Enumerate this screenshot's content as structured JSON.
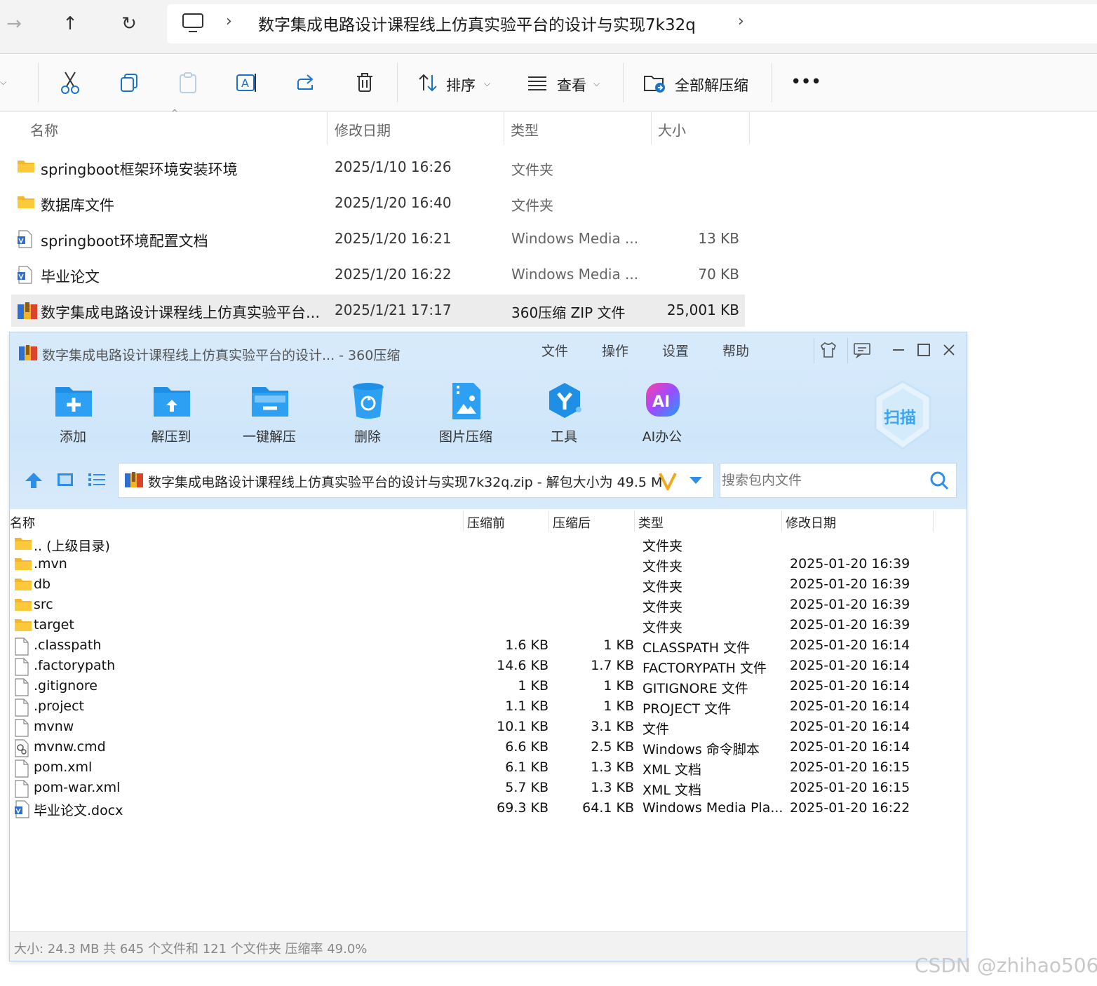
{
  "explorer": {
    "breadcrumb": "数字集成电路设计课程线上仿真实验平台的设计与实现7k32q",
    "toolbar": {
      "sort_label": "排序",
      "view_label": "查看",
      "extract_all_label": "全部解压缩",
      "more_label": "•••"
    },
    "columns": {
      "name": "名称",
      "date": "修改日期",
      "type": "类型",
      "size": "大小"
    },
    "files": [
      {
        "name": "springboot框架环境安装环境",
        "date": "2025/1/10 16:26",
        "type": "文件夹",
        "size": "",
        "icon": "folder-icon"
      },
      {
        "name": "数据库文件",
        "date": "2025/1/20 16:40",
        "type": "文件夹",
        "size": "",
        "icon": "folder-icon"
      },
      {
        "name": "springboot环境配置文档",
        "date": "2025/1/20 16:21",
        "type": "Windows Media ...",
        "size": "13 KB",
        "icon": "document-icon"
      },
      {
        "name": "毕业论文",
        "date": "2025/1/20 16:22",
        "type": "Windows Media ...",
        "size": "70 KB",
        "icon": "document-icon"
      },
      {
        "name": "数字集成电路设计课程线上仿真实验平台...",
        "date": "2025/1/21 17:17",
        "type": "360压缩 ZIP 文件",
        "size": "25,001 KB",
        "icon": "zip-icon",
        "selected": true
      }
    ]
  },
  "zip_window": {
    "title": "数字集成电路设计课程线上仿真实验平台的设计... - 360压缩",
    "menu": [
      "文件",
      "操作",
      "设置",
      "帮助"
    ],
    "buttons": [
      "添加",
      "解压到",
      "一键解压",
      "删除",
      "图片压缩",
      "工具",
      "AI办公"
    ],
    "scan_label": "扫描",
    "path": "数字集成电路设计课程线上仿真实验平台的设计与实现7k32q.zip - 解包大小为 49.5 M",
    "search_placeholder": "搜索包内文件",
    "columns": {
      "name": "名称",
      "before": "压缩前",
      "after": "压缩后",
      "type": "类型",
      "date": "修改日期"
    },
    "rows": [
      {
        "name": ".. (上级目录)",
        "before": "",
        "after": "",
        "type": "文件夹",
        "date": "",
        "icon": "folder-icon"
      },
      {
        "name": ".mvn",
        "before": "",
        "after": "",
        "type": "文件夹",
        "date": "2025-01-20 16:39",
        "icon": "folder-icon"
      },
      {
        "name": "db",
        "before": "",
        "after": "",
        "type": "文件夹",
        "date": "2025-01-20 16:39",
        "icon": "folder-icon"
      },
      {
        "name": "src",
        "before": "",
        "after": "",
        "type": "文件夹",
        "date": "2025-01-20 16:39",
        "icon": "folder-icon"
      },
      {
        "name": "target",
        "before": "",
        "after": "",
        "type": "文件夹",
        "date": "2025-01-20 16:39",
        "icon": "folder-icon"
      },
      {
        "name": ".classpath",
        "before": "1.6 KB",
        "after": "1 KB",
        "type": "CLASSPATH 文件",
        "date": "2025-01-20 16:14",
        "icon": "file-icon"
      },
      {
        "name": ".factorypath",
        "before": "14.6 KB",
        "after": "1.7 KB",
        "type": "FACTORYPATH 文件",
        "date": "2025-01-20 16:14",
        "icon": "file-icon"
      },
      {
        "name": ".gitignore",
        "before": "1 KB",
        "after": "1 KB",
        "type": "GITIGNORE 文件",
        "date": "2025-01-20 16:14",
        "icon": "file-icon"
      },
      {
        "name": ".project",
        "before": "1.1 KB",
        "after": "1 KB",
        "type": "PROJECT 文件",
        "date": "2025-01-20 16:14",
        "icon": "file-icon"
      },
      {
        "name": "mvnw",
        "before": "10.1 KB",
        "after": "3.1 KB",
        "type": "文件",
        "date": "2025-01-20 16:14",
        "icon": "file-icon"
      },
      {
        "name": "mvnw.cmd",
        "before": "6.6 KB",
        "after": "2.5 KB",
        "type": "Windows 命令脚本",
        "date": "2025-01-20 16:14",
        "icon": "script-icon"
      },
      {
        "name": "pom.xml",
        "before": "6.1 KB",
        "after": "1.3 KB",
        "type": "XML 文档",
        "date": "2025-01-20 16:15",
        "icon": "file-icon"
      },
      {
        "name": "pom-war.xml",
        "before": "5.7 KB",
        "after": "1.3 KB",
        "type": "XML 文档",
        "date": "2025-01-20 16:15",
        "icon": "file-icon"
      },
      {
        "name": "毕业论文.docx",
        "before": "69.3 KB",
        "after": "64.1 KB",
        "type": "Windows Media Pla...",
        "date": "2025-01-20 16:22",
        "icon": "document-icon"
      }
    ],
    "status": "大小: 24.3 MB 共 645 个文件和 121 个文件夹 压缩率 49.0%"
  },
  "watermark": "CSDN @zhihao506"
}
